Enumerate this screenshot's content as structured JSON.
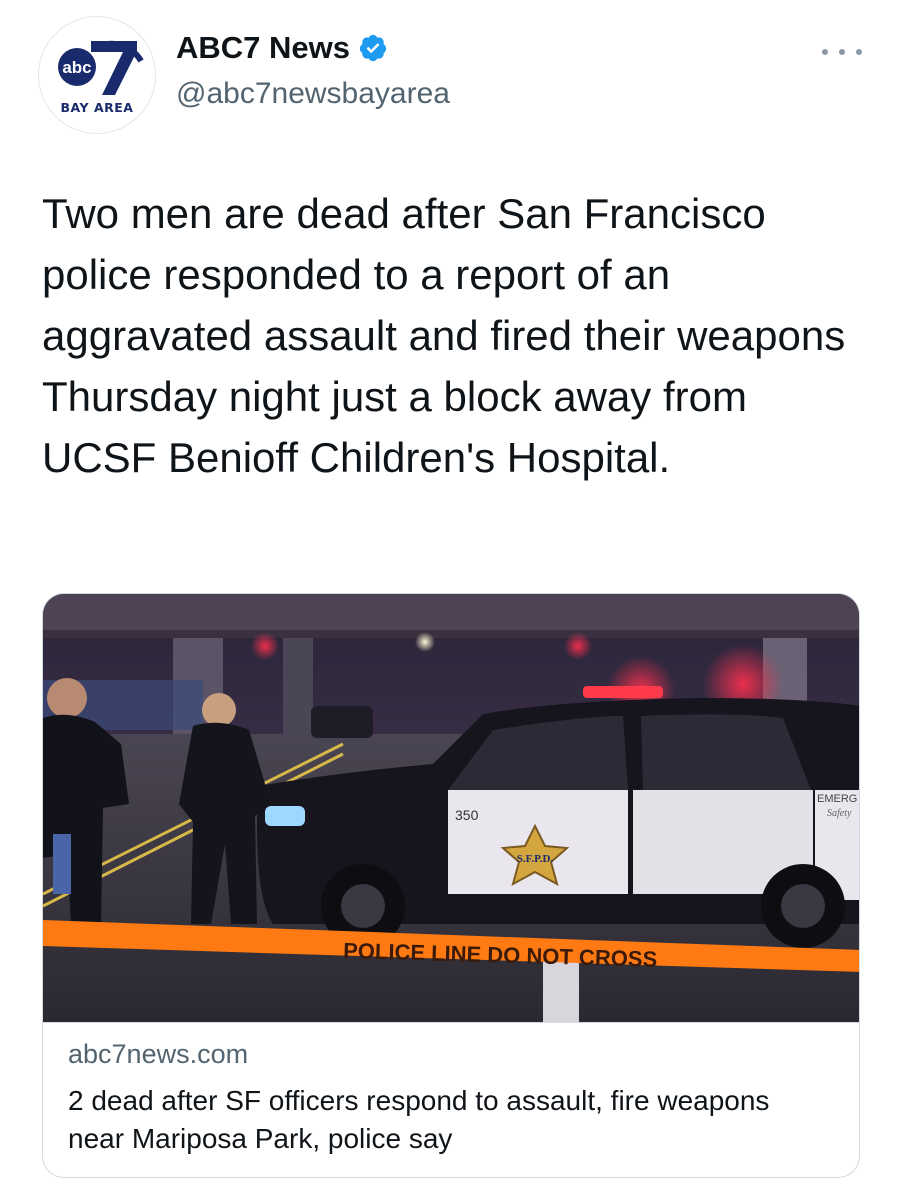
{
  "account": {
    "display_name": "ABC7 News",
    "handle": "@abc7newsbayarea",
    "avatar_logo_text": "abc",
    "avatar_caption": "BAY AREA",
    "verified": true
  },
  "tweet": {
    "text": "Two men are dead after San Francisco police responded to a report of an aggravated assault and fired their weapons Thursday night just a block away from UCSF Benioff Children's Hospital."
  },
  "card": {
    "domain": "abc7news.com",
    "title": "2 dead after SF officers respond to assault, fire weapons near Mariposa Park, police say",
    "image": {
      "tape_text": "POLICE LINE DO NOT CROSS",
      "car_number": "350",
      "badge_text": "S.F.P.D.",
      "car_door_text": "EMERG",
      "car_door_subtext": "Safety"
    }
  },
  "icons": {
    "verified": "verified-badge-icon",
    "more": "more-options-icon"
  },
  "colors": {
    "verified_blue": "#1d9bf0",
    "text_primary": "#0f1419",
    "text_secondary": "#536471",
    "border": "#cfd9de",
    "abc_navy": "#1a2b6d",
    "tape_orange": "#ff7a12"
  }
}
